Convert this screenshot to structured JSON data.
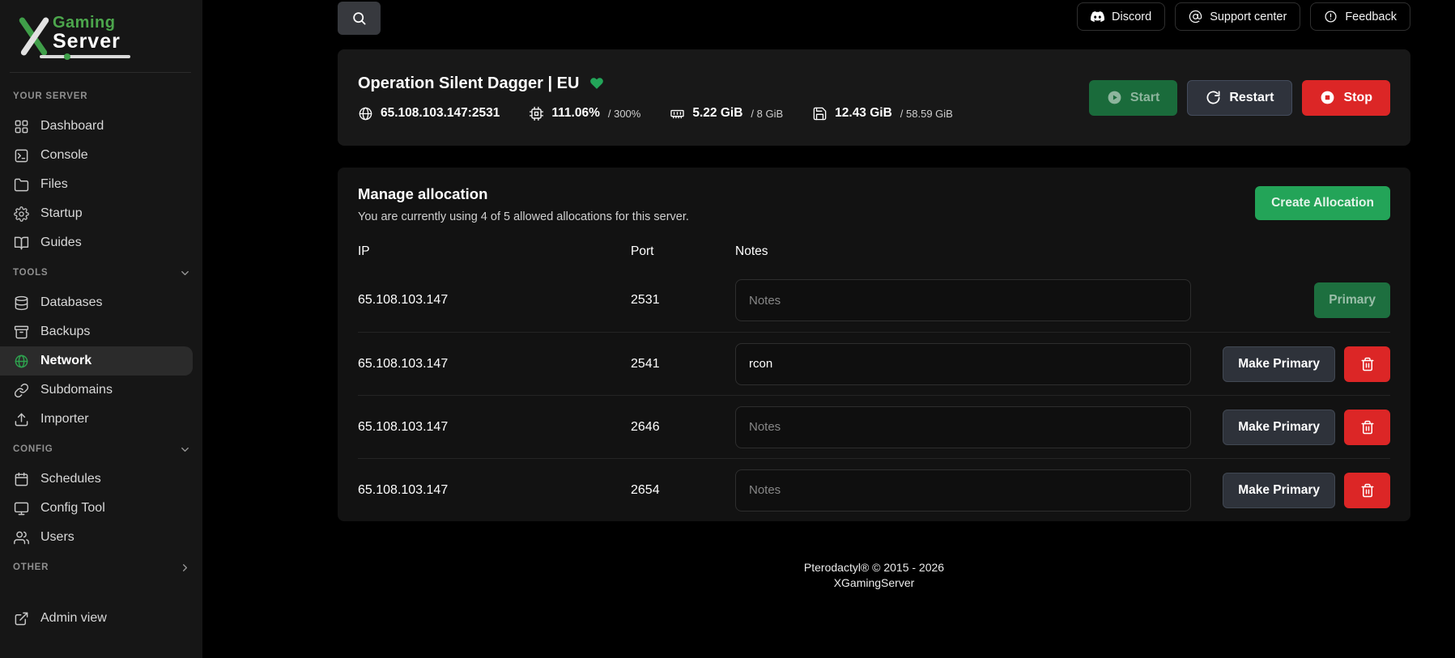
{
  "colors": {
    "accent_green": "#23a559",
    "create_button_green": "#23a458",
    "start_button_green": "#1a6b3b",
    "danger_red": "#dc2626",
    "sidebar_bg": "#161616",
    "card_bg": "#181818"
  },
  "brand": {
    "gaming": "Gaming",
    "server": "Server"
  },
  "topbar": {
    "discord": "Discord",
    "support": "Support center",
    "feedback": "Feedback"
  },
  "sidebar": {
    "sections": [
      {
        "label": "YOUR SERVER",
        "items": [
          {
            "label": "Dashboard"
          },
          {
            "label": "Console"
          },
          {
            "label": "Files"
          },
          {
            "label": "Startup"
          },
          {
            "label": "Guides"
          }
        ]
      },
      {
        "label": "TOOLS",
        "items": [
          {
            "label": "Databases"
          },
          {
            "label": "Backups"
          },
          {
            "label": "Network",
            "active": true
          },
          {
            "label": "Subdomains"
          },
          {
            "label": "Importer"
          }
        ]
      },
      {
        "label": "CONFIG",
        "items": [
          {
            "label": "Schedules"
          },
          {
            "label": "Config Tool"
          },
          {
            "label": "Users"
          }
        ]
      },
      {
        "label": "OTHER",
        "items": []
      }
    ],
    "admin_view": "Admin view"
  },
  "server": {
    "name": "Operation Silent Dagger | EU",
    "address": "65.108.103.147:2531",
    "cpu_usage": "111.06%",
    "cpu_limit": "/ 300%",
    "memory_usage": "5.22 GiB",
    "memory_limit": "/ 8 GiB",
    "disk_usage": "12.43 GiB",
    "disk_limit": "/ 58.59 GiB",
    "start_label": "Start",
    "restart_label": "Restart",
    "stop_label": "Stop"
  },
  "allocation": {
    "title": "Manage allocation",
    "subtitle": "You are currently using 4 of 5 allowed allocations for this server.",
    "create_label": "Create Allocation",
    "headers": {
      "ip": "IP",
      "port": "Port",
      "notes": "Notes"
    },
    "rows": [
      {
        "ip": "65.108.103.147",
        "port": "2531",
        "note_value": "",
        "note_placeholder": "Notes",
        "primary_label": "Primary"
      },
      {
        "ip": "65.108.103.147",
        "port": "2541",
        "note_value": "rcon",
        "note_placeholder": "Notes",
        "make_primary_label": "Make Primary"
      },
      {
        "ip": "65.108.103.147",
        "port": "2646",
        "note_value": "",
        "note_placeholder": "Notes",
        "make_primary_label": "Make Primary"
      },
      {
        "ip": "65.108.103.147",
        "port": "2654",
        "note_value": "",
        "note_placeholder": "Notes",
        "make_primary_label": "Make Primary"
      }
    ]
  },
  "footer": {
    "line1": "Pterodactyl® © 2015 - 2026",
    "line2": "XGamingServer"
  }
}
